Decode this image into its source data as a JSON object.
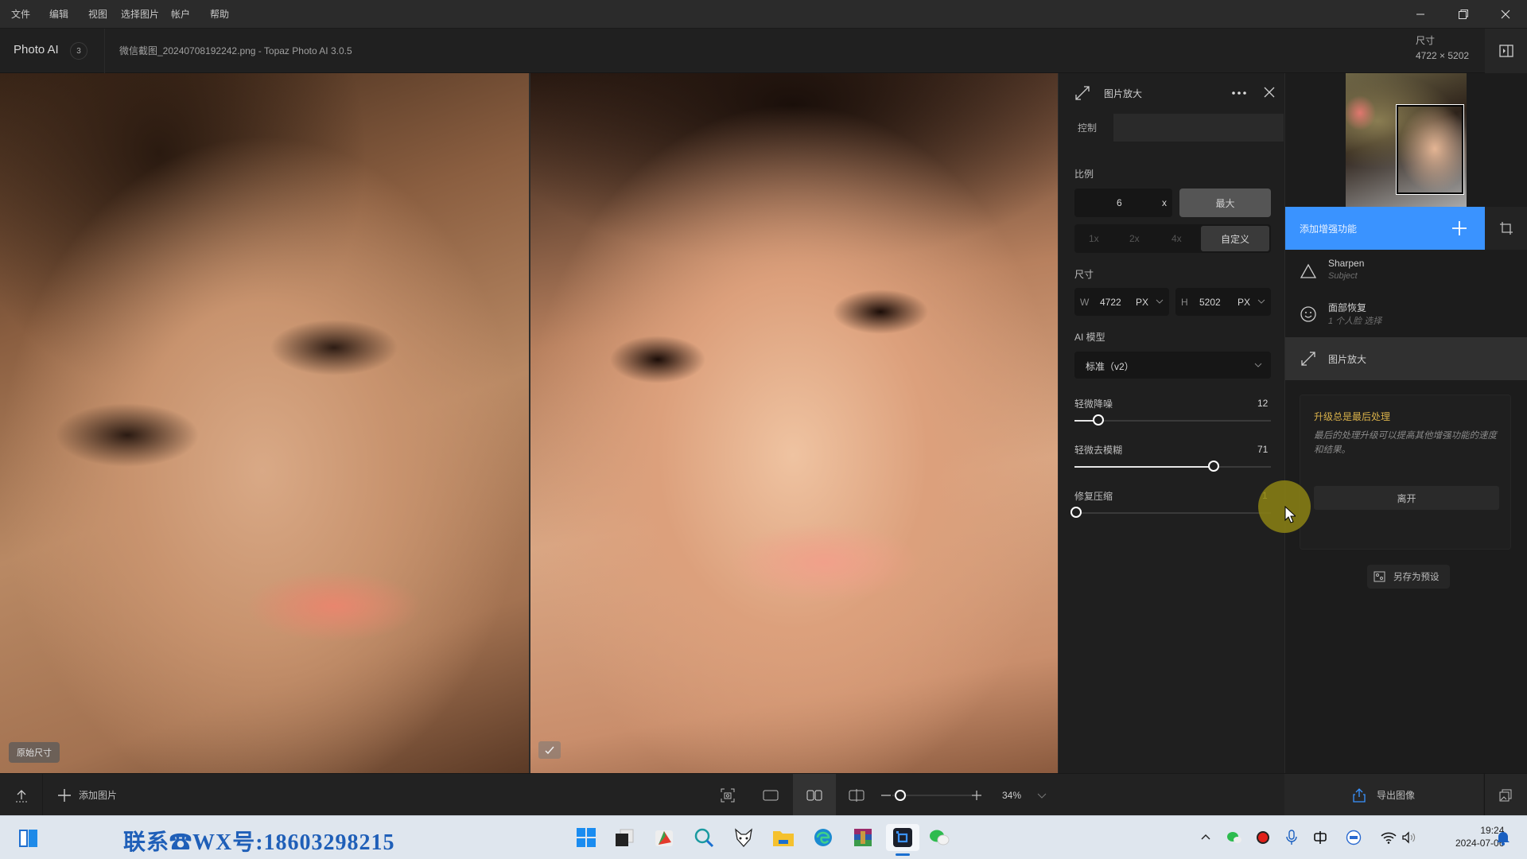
{
  "menu": {
    "items": [
      "文件",
      "编辑",
      "视图",
      "选择图片",
      "帐户",
      "帮助"
    ]
  },
  "window": {
    "minimize": "minimize",
    "restore": "restore",
    "close": "close"
  },
  "titlebar": {
    "app_name": "Photo AI",
    "image_count": "3",
    "file_title": "微信截图_20240708192242.png - Topaz Photo AI 3.0.5",
    "size_label": "尺寸",
    "size_value": "4722 × 5202"
  },
  "preview": {
    "original_label": "原始尺寸",
    "processed_badge": "✓"
  },
  "panel": {
    "title": "图片放大",
    "tab_controls": "控制",
    "scale_label": "比例",
    "scale_value": "6",
    "scale_unit": "x",
    "max_button": "最大",
    "presets": [
      "1x",
      "2x",
      "4x",
      "自定义"
    ],
    "preset_selected": "自定义",
    "dimension_label": "尺寸",
    "width_prefix": "W",
    "width_value": "4722",
    "width_unit": "PX",
    "height_prefix": "H",
    "height_value": "5202",
    "height_unit": "PX",
    "model_label": "AI 模型",
    "model_value": "标准（v2）",
    "sliders": [
      {
        "label": "轻微降噪",
        "value": 12,
        "display": "12"
      },
      {
        "label": "轻微去模糊",
        "value": 71,
        "display": "71"
      },
      {
        "label": "修复压缩",
        "value": 1,
        "display": "1"
      }
    ]
  },
  "sidebar": {
    "add_enhancement": "添加增强功能",
    "enhancements": [
      {
        "name": "Sharpen",
        "sub": "Subject",
        "icon": "triangle-icon"
      },
      {
        "name": "面部恢复",
        "sub": "1 个人脸 选择",
        "icon": "face-icon"
      },
      {
        "name": "图片放大",
        "sub": "",
        "icon": "expand-icon"
      }
    ],
    "tip_title": "升级总是最后处理",
    "tip_body": "最后的处理升级可以提高其他增强功能的速度和结果。",
    "tip_button": "离开",
    "save_preset": "另存为预设",
    "export": "导出图像"
  },
  "bottombar": {
    "add_image": "添加图片",
    "zoom_value": "34%",
    "zoom_fraction": 0.1
  },
  "taskbar": {
    "promo_text": "联系☎WX号:18603298215",
    "time": "19:24",
    "date": "2024-07-06",
    "apps": [
      "start",
      "task-view",
      "snip",
      "search",
      "fox-app",
      "file-explorer",
      "edge",
      "winrar",
      "topaz-photo-ai",
      "wechat"
    ]
  },
  "colors": {
    "accent": "#3a93ff",
    "tip_title": "#d8b04a",
    "cursor_highlight": "#8c8214"
  }
}
